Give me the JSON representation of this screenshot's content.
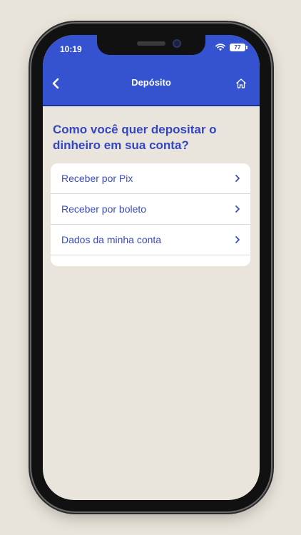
{
  "status_bar": {
    "time": "10:19",
    "battery": "77"
  },
  "header": {
    "title": "Depósito",
    "back_icon": "chevron-left-icon",
    "home_icon": "home-icon"
  },
  "main": {
    "question": "Como você quer depositar o dinheiro em sua conta?",
    "options": [
      {
        "label": "Receber por Pix"
      },
      {
        "label": "Receber por boleto"
      },
      {
        "label": "Dados da minha conta"
      }
    ]
  },
  "colors": {
    "accent": "#3552d0",
    "text_accent": "#3346c4",
    "background": "#e9e5dc"
  }
}
